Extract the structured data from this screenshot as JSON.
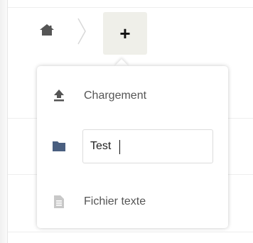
{
  "breadcrumb": {
    "home_icon": "home-icon",
    "separator_icon": "chevron-right-icon"
  },
  "new_button": {
    "label": "+"
  },
  "new_menu": {
    "items": [
      {
        "icon": "upload-icon",
        "label": "Chargement"
      },
      {
        "icon": "folder-icon",
        "input_value": "Test"
      },
      {
        "icon": "text-file-icon",
        "label": "Fichier texte"
      }
    ]
  },
  "colors": {
    "folder": "#4a5f80",
    "upload_icon": "#555555",
    "text_file_icon": "#c8c8c8",
    "button_bg": "#efefe9"
  }
}
